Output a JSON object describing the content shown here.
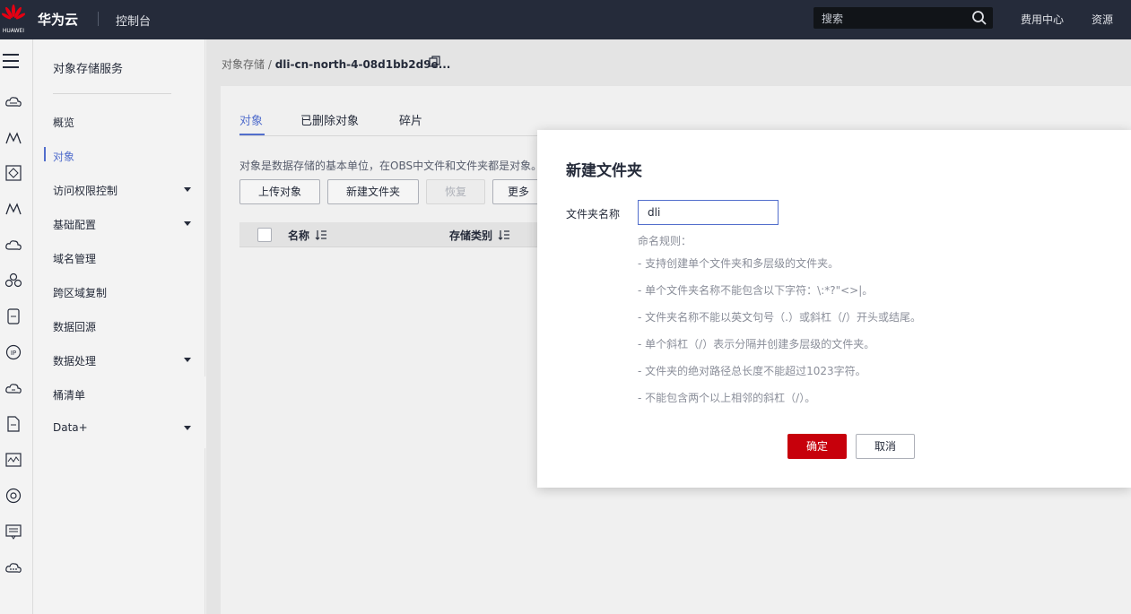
{
  "colors": {
    "topbar_bg": "#252b3a",
    "accent": "#526ecc",
    "primary_button": "#c7000b"
  },
  "topbar": {
    "logo_text": "HUAWEI",
    "brand": "华为云",
    "console": "控制台",
    "search_placeholder": "搜索",
    "links": [
      "费用中心",
      "资源"
    ]
  },
  "rail": {
    "icons": [
      "menu-icon",
      "cloud-server-icon",
      "mountain-icon",
      "security-icon",
      "mountain-icon",
      "cloud-icon",
      "cluster-icon",
      "storage-icon",
      "ip-icon",
      "cloud-icon",
      "document-icon",
      "monitor-icon",
      "settings-icon",
      "message-icon",
      "more-icon"
    ]
  },
  "sidenav": {
    "title": "对象存储服务",
    "items": [
      {
        "label": "概览",
        "active": false,
        "expandable": false
      },
      {
        "label": "对象",
        "active": true,
        "expandable": false
      },
      {
        "label": "访问权限控制",
        "active": false,
        "expandable": true
      },
      {
        "label": "基础配置",
        "active": false,
        "expandable": true
      },
      {
        "label": "域名管理",
        "active": false,
        "expandable": false
      },
      {
        "label": "跨区域复制",
        "active": false,
        "expandable": false
      },
      {
        "label": "数据回源",
        "active": false,
        "expandable": false
      },
      {
        "label": "数据处理",
        "active": false,
        "expandable": true
      },
      {
        "label": "桶清单",
        "active": false,
        "expandable": false
      },
      {
        "label": "Data+",
        "active": false,
        "expandable": true
      }
    ]
  },
  "breadcrumb": {
    "parent": "对象存储",
    "separator": "/",
    "current": "dli-cn-north-4-08d1bb2d9e..."
  },
  "tabs": [
    {
      "label": "对象",
      "active": true
    },
    {
      "label": "已删除对象",
      "active": false
    },
    {
      "label": "碎片",
      "active": false
    }
  ],
  "description": "对象是数据存储的基本单位，在OBS中文件和文件夹都是对象。",
  "toolbar": {
    "upload": "上传对象",
    "new_folder": "新建文件夹",
    "restore": "恢复",
    "more": "更多"
  },
  "table": {
    "columns": [
      "名称",
      "存储类别"
    ]
  },
  "dialog": {
    "title": "新建文件夹",
    "field_label": "文件夹名称",
    "field_value": "dli",
    "rules_head": "命名规则：",
    "rules": [
      "- 支持创建单个文件夹和多层级的文件夹。",
      "- 单个文件夹名称不能包含以下字符：\\:*?\"<>|。",
      "- 文件夹名称不能以英文句号（.）或斜杠（/）开头或结尾。",
      "- 单个斜杠（/）表示分隔并创建多层级的文件夹。",
      "- 文件夹的绝对路径总长度不能超过1023字符。",
      "- 不能包含两个以上相邻的斜杠（/）。"
    ],
    "ok": "确定",
    "cancel": "取消"
  }
}
